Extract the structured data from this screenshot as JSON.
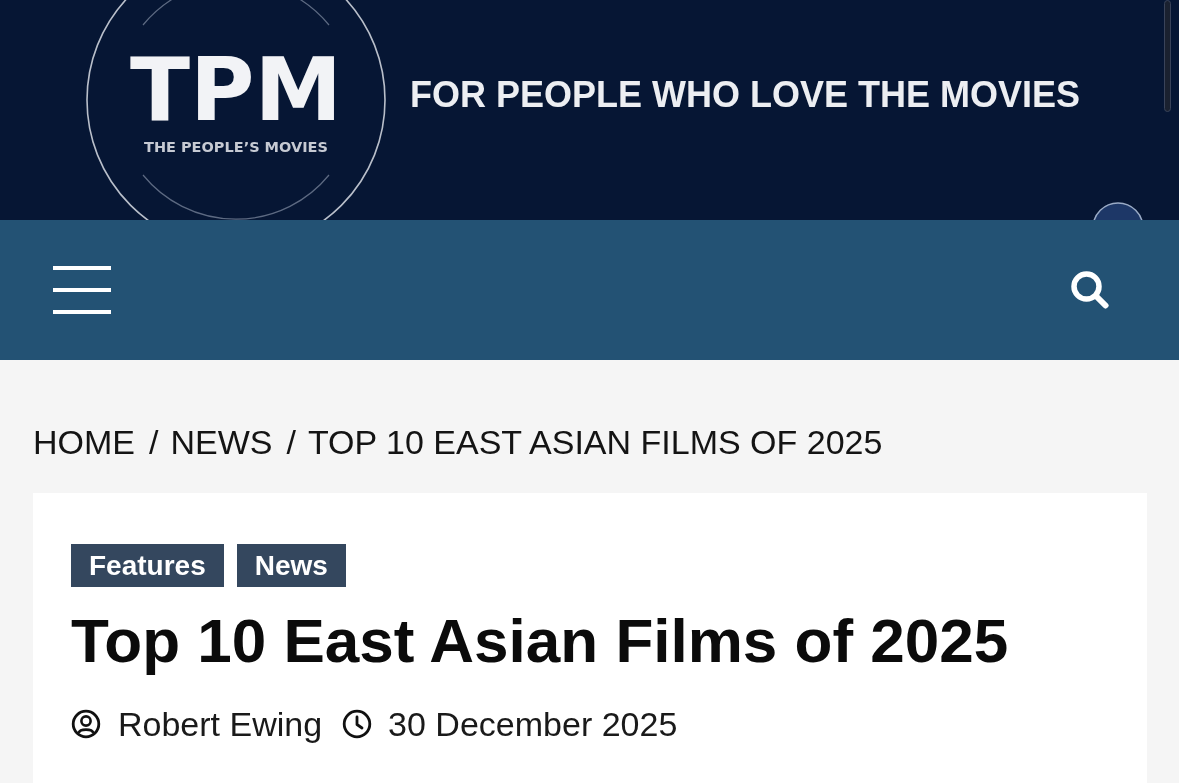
{
  "header": {
    "logo": {
      "mark": "TPM",
      "name": "THE PEOPLE’S MOVIES"
    },
    "tagline": "FOR PEOPLE WHO LOVE THE MOVIES"
  },
  "breadcrumb": {
    "items": [
      {
        "label": "HOME"
      },
      {
        "separator": "/",
        "label": "NEWS"
      },
      {
        "separator": "/",
        "label": "TOP 10 EAST ASIAN FILMS OF 2025"
      }
    ]
  },
  "article": {
    "categories": [
      "Features",
      "News"
    ],
    "title": "Top 10 East Asian Films of 2025",
    "author": "Robert Ewing",
    "date": "30 December 2025"
  }
}
